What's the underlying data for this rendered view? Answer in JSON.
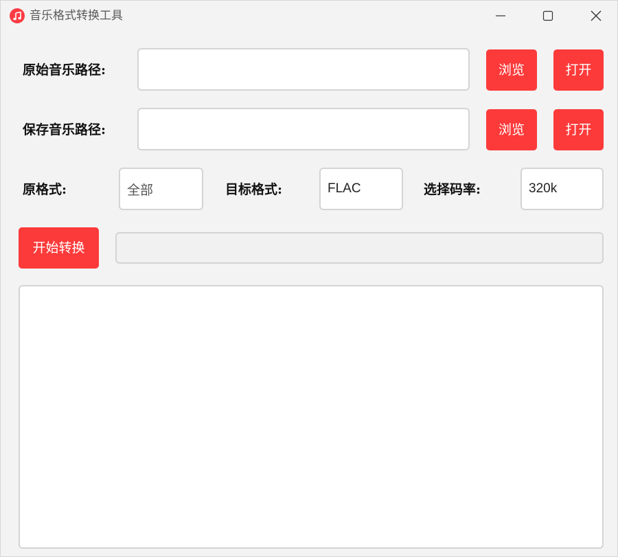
{
  "window": {
    "title": "音乐格式转换工具",
    "icon": "music-note-icon",
    "accent": "#fc3a3a"
  },
  "source_path": {
    "label": "原始音乐路径:",
    "value": "",
    "browse_label": "浏览",
    "open_label": "打开"
  },
  "save_path": {
    "label": "保存音乐路径:",
    "value": "",
    "browse_label": "浏览",
    "open_label": "打开"
  },
  "formats": {
    "source_label": "原格式:",
    "source_value": "全部",
    "target_label": "目标格式:",
    "target_value": "FLAC",
    "bitrate_label": "选择码率:",
    "bitrate_value": "320k"
  },
  "actions": {
    "start_label": "开始转换",
    "progress": 0
  },
  "log": {
    "content": ""
  }
}
